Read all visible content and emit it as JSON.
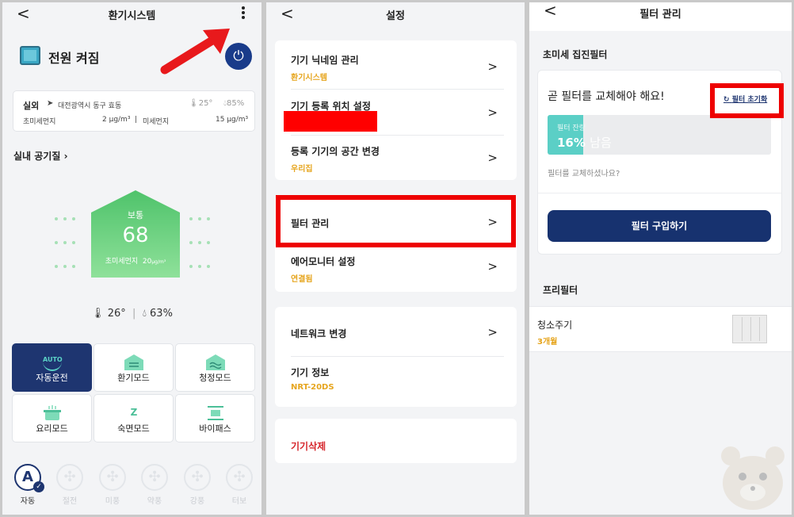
{
  "panel1": {
    "header": {
      "back": "<",
      "title": "환기시스템"
    },
    "power": {
      "label": "전원 켜짐",
      "button_icon": "⏻"
    },
    "weather": {
      "title": "실외",
      "location": "대전광역시 동구 효동",
      "temp": "25°",
      "humidity": "85%",
      "fine_dust_label": "초미세먼지",
      "fine_dust_value": "2 μg/m³",
      "pm10_label": "미세먼지",
      "pm10_value": "15 μg/m³"
    },
    "indoor_label": "실내 공기질",
    "air": {
      "status": "보통",
      "value": "68",
      "sub": "초미세먼지",
      "sub_value": "20",
      "sub_unit": "μg/m³"
    },
    "climate": {
      "temp": "26°",
      "humidity": "63%"
    },
    "modes": [
      {
        "label": "자동운전",
        "selected": true,
        "icon": "auto-icon"
      },
      {
        "label": "환기모드",
        "selected": false,
        "icon": "ventilation-icon"
      },
      {
        "label": "청정모드",
        "selected": false,
        "icon": "purify-icon"
      },
      {
        "label": "요리모드",
        "selected": false,
        "icon": "cooking-icon"
      },
      {
        "label": "숙면모드",
        "selected": false,
        "icon": "sleep-icon"
      },
      {
        "label": "바이패스",
        "selected": false,
        "icon": "bypass-icon"
      }
    ],
    "auto_icon_text": "AUTO",
    "sleep_icon_text": "Z",
    "fans": [
      {
        "label": "자동",
        "glyph": "A",
        "selected": true
      },
      {
        "label": "절전",
        "glyph": "✣",
        "selected": false
      },
      {
        "label": "미풍",
        "glyph": "✣",
        "selected": false
      },
      {
        "label": "약풍",
        "glyph": "✣",
        "selected": false
      },
      {
        "label": "강풍",
        "glyph": "✣",
        "selected": false
      },
      {
        "label": "터보",
        "glyph": "✣",
        "selected": false
      }
    ],
    "colors": {
      "accent": "#1e3570",
      "good": "#5fcf78",
      "arrow": "#e8191c"
    }
  },
  "panel2": {
    "header": {
      "back": "<",
      "title": "설정"
    },
    "items_group1": [
      {
        "title": "기기 닉네임 관리",
        "sub": "환기시스템"
      },
      {
        "title": "기기 등록 위치 설정",
        "sub": ""
      },
      {
        "title": "등록 기기의 공간 변경",
        "sub": "우리집"
      }
    ],
    "items_group2": [
      {
        "title": "필터 관리",
        "sub": ""
      },
      {
        "title": "에어모니터 설정",
        "sub": "연결됨"
      }
    ],
    "items_group3": [
      {
        "title": "네트워크 변경",
        "sub": ""
      },
      {
        "title": "기기 정보",
        "sub": "NRT-20DS"
      }
    ],
    "delete_label": "기기삭제",
    "chevron": ">"
  },
  "panel3": {
    "header": {
      "back": "<",
      "title": "필터 관리"
    },
    "section1": "초미세 집진필터",
    "message": "곧 필터를 교체해야 해요!",
    "bar_label": "필터 잔량",
    "bar_percent": "16%",
    "bar_remaining": "남음",
    "remaining_fraction": 0.16,
    "question": "필터를 교체하셨나요?",
    "reset_label": "필터 초기화",
    "reset_icon": "↻",
    "buy_label": "필터 구입하기",
    "section2": "프리필터",
    "prefilter_title": "청소주기",
    "prefilter_value": "3개월"
  }
}
